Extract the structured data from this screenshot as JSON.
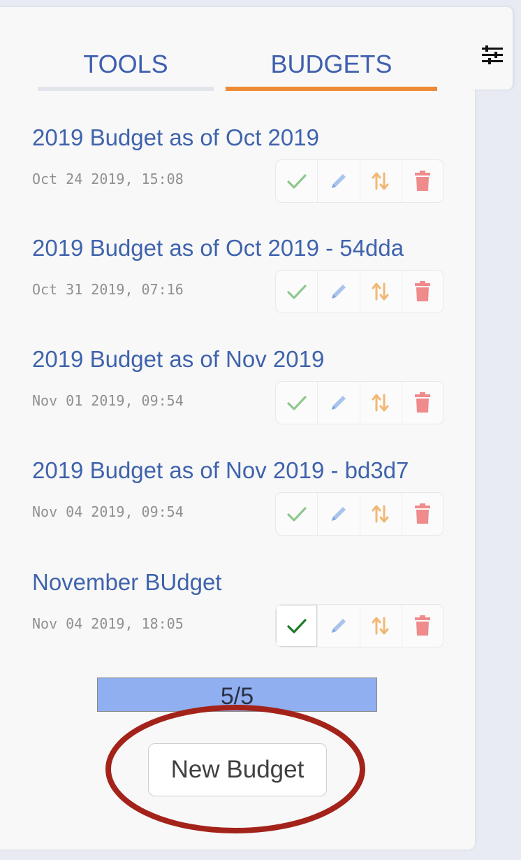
{
  "tabs": {
    "tools_label": "TOOLS",
    "budgets_label": "BUDGETS",
    "active": "BUDGETS"
  },
  "settings_toggle": {
    "icon": "sliders-icon"
  },
  "budgets": [
    {
      "title": "2019 Budget as of Oct 2019",
      "date": "Oct 24 2019, 15:08",
      "active": false
    },
    {
      "title": "2019 Budget as of Oct 2019 - 54dda",
      "date": "Oct 31 2019, 07:16",
      "active": false
    },
    {
      "title": "2019 Budget as of Nov 2019",
      "date": "Nov 01 2019, 09:54",
      "active": false
    },
    {
      "title": "2019 Budget as of Nov 2019 - bd3d7",
      "date": "Nov 04 2019, 09:54",
      "active": false
    },
    {
      "title": "November BUdget",
      "date": "Nov 04 2019, 18:05",
      "active": true
    }
  ],
  "action_icons": [
    "check-icon",
    "pencil-icon",
    "sort-arrows-icon",
    "trash-icon"
  ],
  "progress": {
    "label": "5/5",
    "used": 5,
    "max": 5
  },
  "new_budget_label": "New Budget",
  "colors": {
    "accent": "#ee8a35",
    "link": "#3f63ac",
    "progress_fill": "#8faff0",
    "highlight_ring": "#a3231a"
  }
}
